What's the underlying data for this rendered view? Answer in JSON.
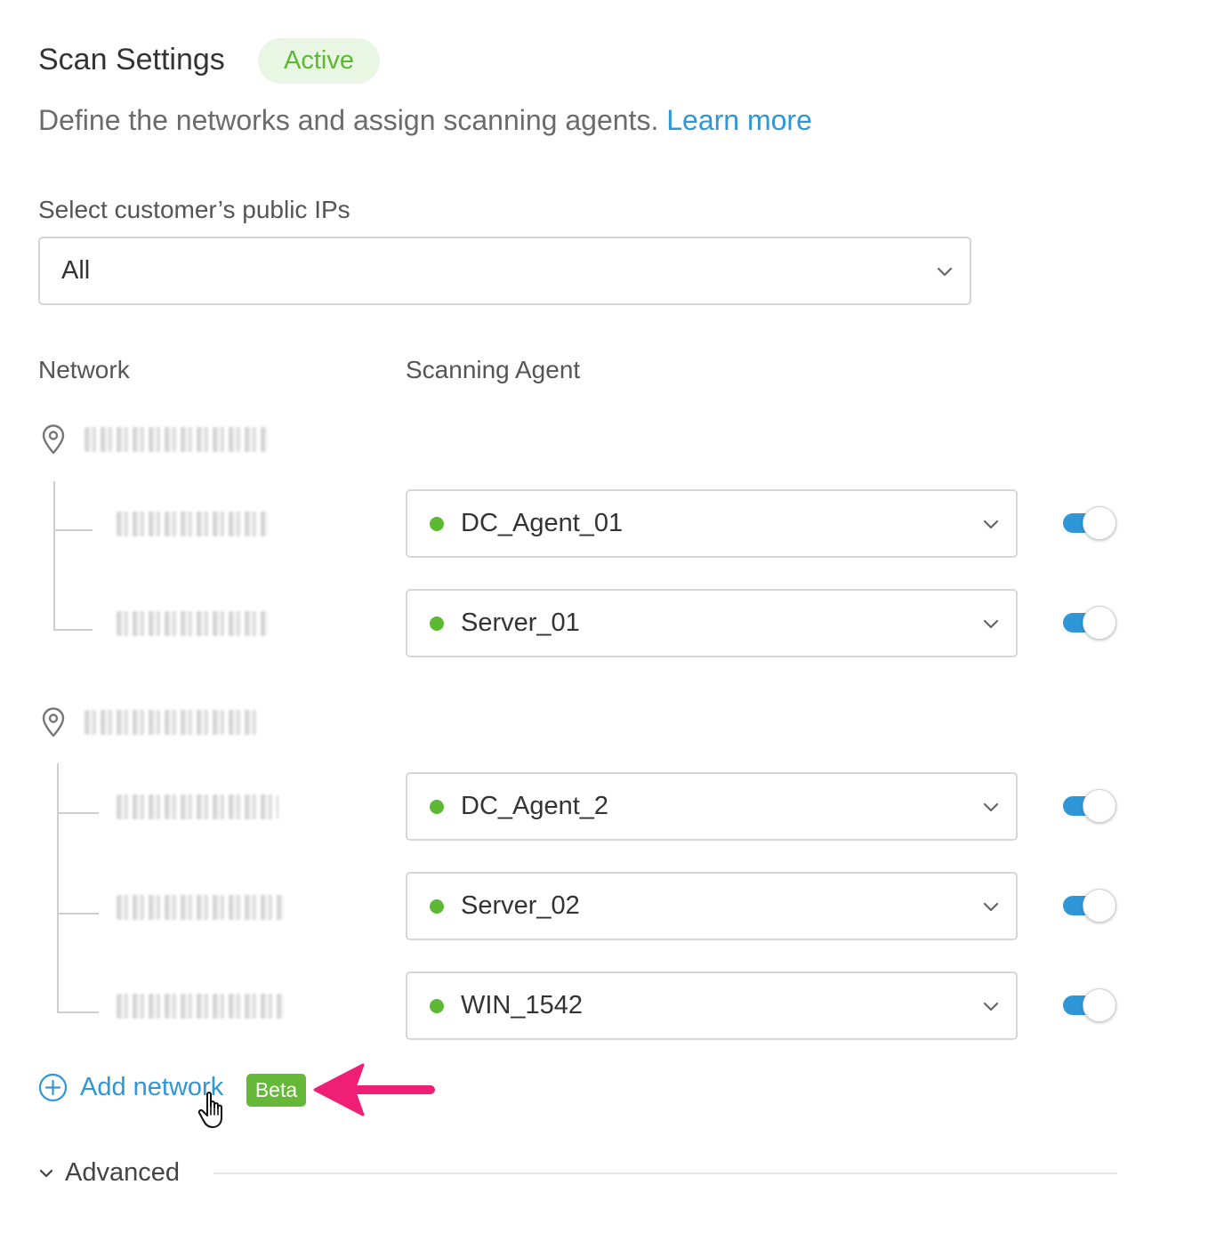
{
  "header": {
    "title": "Scan Settings",
    "status_badge": "Active"
  },
  "description": {
    "text": "Define the networks and assign scanning agents.",
    "link_label": "Learn more"
  },
  "public_ips": {
    "label": "Select customer’s public IPs",
    "selected": "All"
  },
  "columns": {
    "network": "Network",
    "agent": "Scanning Agent"
  },
  "networks": [
    {
      "agents": [
        {
          "name": "DC_Agent_01",
          "status_color": "#5db832",
          "enabled": true
        },
        {
          "name": "Server_01",
          "status_color": "#5db832",
          "enabled": true
        }
      ]
    },
    {
      "agents": [
        {
          "name": "DC_Agent_2",
          "status_color": "#5db832",
          "enabled": true
        },
        {
          "name": "Server_02",
          "status_color": "#5db832",
          "enabled": true
        },
        {
          "name": "WIN_1542",
          "status_color": "#5db832",
          "enabled": true
        }
      ]
    }
  ],
  "add_network": {
    "label": "Add network",
    "badge": "Beta"
  },
  "advanced": {
    "label": "Advanced"
  },
  "colors": {
    "accent": "#2f96d8",
    "online": "#5db832",
    "beta": "#66b838",
    "annotation_arrow": "#ee1f74"
  }
}
